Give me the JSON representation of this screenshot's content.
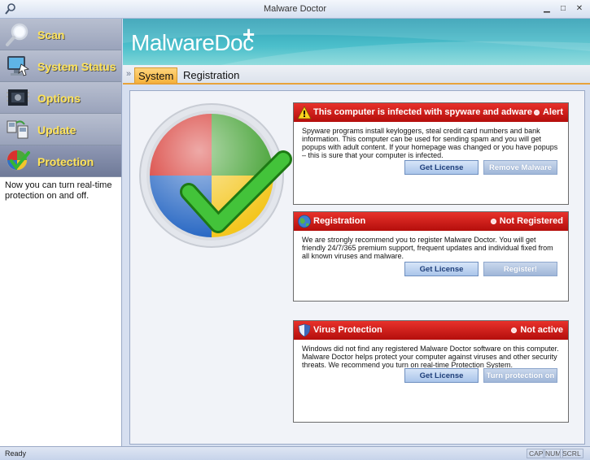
{
  "window": {
    "title": "Malware Doctor"
  },
  "sidebar": {
    "items": [
      {
        "label": "Scan",
        "icon": "scan-magnifier-icon"
      },
      {
        "label": "System Status",
        "icon": "monitor-icon"
      },
      {
        "label": "Options",
        "icon": "options-chip-icon"
      },
      {
        "label": "Update",
        "icon": "update-computers-icon"
      },
      {
        "label": "Protection",
        "icon": "shield-protection-icon"
      }
    ],
    "active": "Protection",
    "description": "Now you can turn real-time protection on and off."
  },
  "banner": {
    "brand": "MalwareDoc",
    "plus": "+"
  },
  "tabs": [
    {
      "label": "System",
      "active": true
    },
    {
      "label": "Registration",
      "active": false
    }
  ],
  "panels": {
    "infected": {
      "title": "This computer is infected with spyware and adware",
      "status": "Alert",
      "text": "Spyware programs install keyloggers, steal credit card numbers and bank information. This computer can be used for sending spam and you will get popups with adult content. If your homepage was changed or you have popups – this is sure that your computer is infected.",
      "button_primary": "Get License",
      "button_secondary": "Remove Malware"
    },
    "registration": {
      "title": "Registration",
      "status": "Not Registered",
      "text": "We are strongly recommend you to register Malware Doctor. You will get friendly 24/7/365 premium support, frequent updates and individual fixed from all known viruses and malware.",
      "button_primary": "Get License",
      "button_secondary": "Register!"
    },
    "virus": {
      "title": "Virus Protection",
      "status": "Not active",
      "text": "Windows did not find any registered Malware Doctor software on this computer. Malware Doctor helps protect your computer against viruses and other security threats. We recommend you turn on real-time Protection System.",
      "button_primary": "Get License",
      "button_secondary": "Turn protection on"
    }
  },
  "statusbar": {
    "status": "Ready",
    "cap": "CAP",
    "num": "NUM",
    "scrl": "SCRL"
  },
  "colors": {
    "alert_red": "#c41a16",
    "banner_teal": "#3fb0c2",
    "nav_label_yellow": "#ffe45a",
    "tab_orange": "#f5b23c"
  }
}
